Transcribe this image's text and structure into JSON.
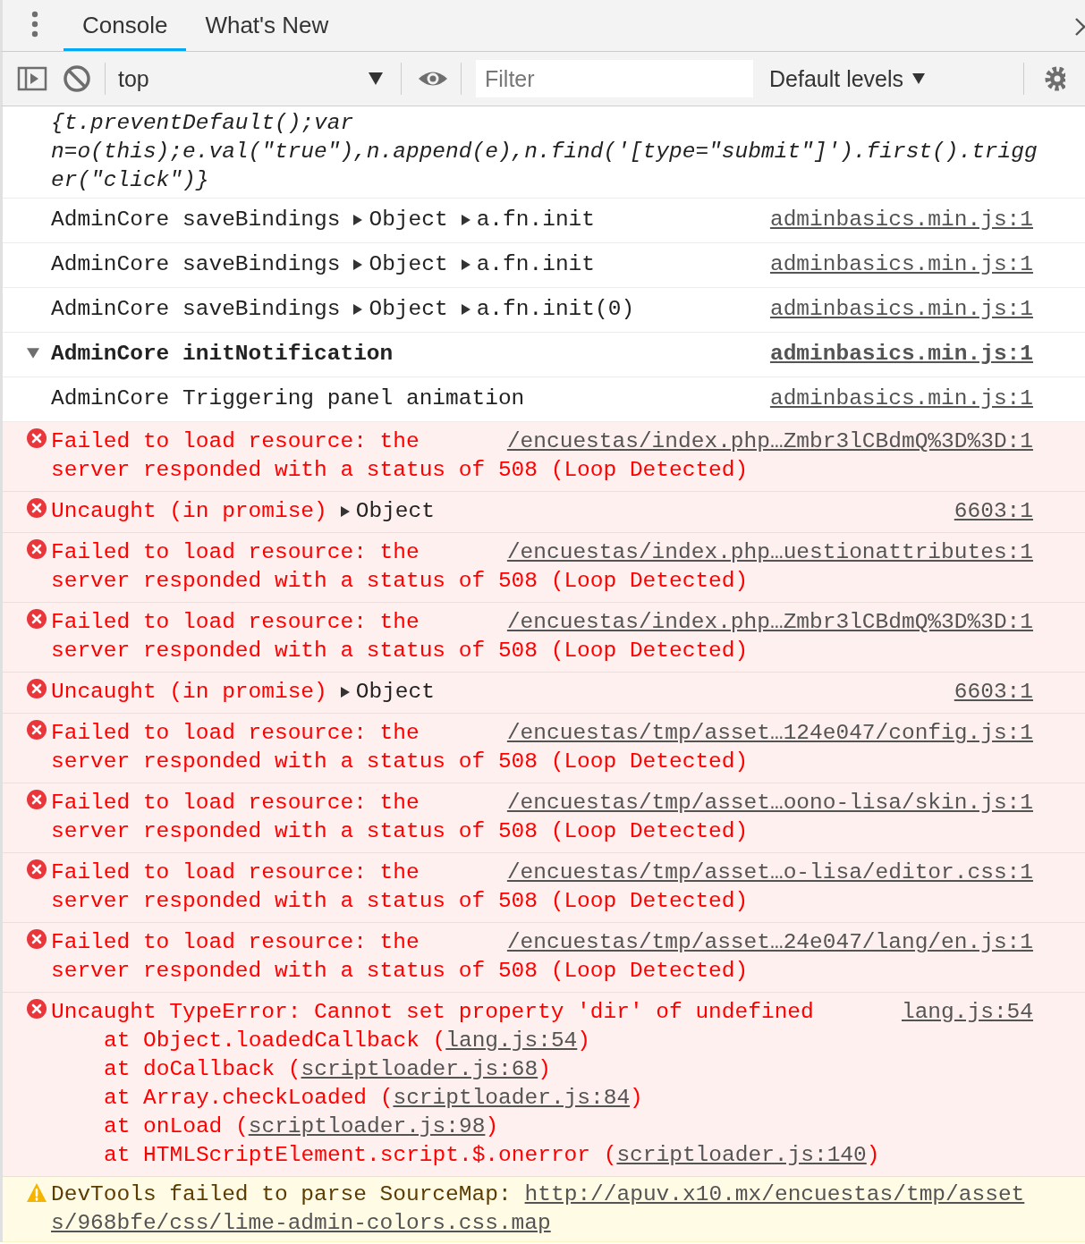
{
  "tabs": [
    {
      "label": "Console",
      "selected": true
    },
    {
      "label": "What's New",
      "selected": false
    }
  ],
  "toolbar": {
    "context": "top",
    "filter": {
      "placeholder": "Filter"
    },
    "levels": "Default levels"
  },
  "messages": [
    {
      "kind": "code",
      "text": "{t.preventDefault();var n=o(this);e.val(\"true\"),n.append(e),n.find('[type=\"submit\"]').first().trigger(\"click\")}"
    },
    {
      "kind": "log",
      "text": "AdminCore saveBindings",
      "objects": [
        "Object",
        "a.fn.init"
      ],
      "source": "adminbasics.min.js:1"
    },
    {
      "kind": "log",
      "text": "AdminCore saveBindings",
      "objects": [
        "Object",
        "a.fn.init"
      ],
      "source": "adminbasics.min.js:1"
    },
    {
      "kind": "log",
      "text": "AdminCore saveBindings",
      "objects": [
        "Object",
        "a.fn.init(0)"
      ],
      "source": "adminbasics.min.js:1"
    },
    {
      "kind": "group",
      "expanded": true,
      "text": "AdminCore initNotification",
      "source": "adminbasics.min.js:1"
    },
    {
      "kind": "log",
      "text": "AdminCore Triggering panel animation",
      "source": "adminbasics.min.js:1"
    },
    {
      "kind": "error",
      "lines": [
        "Failed to load resource: the",
        "server responded with a status of 508 (Loop Detected)"
      ],
      "source": "/encuestas/index.php…Zmbr3lCBdmQ%3D%3D:1"
    },
    {
      "kind": "error",
      "lines": [
        "Uncaught (in promise)"
      ],
      "objects": [
        "Object"
      ],
      "source": "6603:1"
    },
    {
      "kind": "error",
      "lines": [
        "Failed to load resource: the",
        "server responded with a status of 508 (Loop Detected)"
      ],
      "source": "/encuestas/index.php…uestionattributes:1"
    },
    {
      "kind": "error",
      "lines": [
        "Failed to load resource: the",
        "server responded with a status of 508 (Loop Detected)"
      ],
      "source": "/encuestas/index.php…Zmbr3lCBdmQ%3D%3D:1"
    },
    {
      "kind": "error",
      "lines": [
        "Uncaught (in promise)"
      ],
      "objects": [
        "Object"
      ],
      "source": "6603:1"
    },
    {
      "kind": "error",
      "lines": [
        "Failed to load resource: the",
        "server responded with a status of 508 (Loop Detected)"
      ],
      "source": "/encuestas/tmp/asset…124e047/config.js:1"
    },
    {
      "kind": "error",
      "lines": [
        "Failed to load resource: the",
        "server responded with a status of 508 (Loop Detected)"
      ],
      "source": "/encuestas/tmp/asset…oono-lisa/skin.js:1"
    },
    {
      "kind": "error",
      "lines": [
        "Failed to load resource: the",
        "server responded with a status of 508 (Loop Detected)"
      ],
      "source": "/encuestas/tmp/asset…o-lisa/editor.css:1"
    },
    {
      "kind": "error",
      "lines": [
        "Failed to load resource: the",
        "server responded with a status of 508 (Loop Detected)"
      ],
      "source": "/encuestas/tmp/asset…24e047/lang/en.js:1"
    },
    {
      "kind": "error",
      "lines": [
        "Uncaught TypeError: Cannot set property 'dir' of undefined"
      ],
      "source": "lang.js:54",
      "stack": [
        {
          "before": "at Object.loadedCallback (",
          "link": "lang.js:54",
          "after": ")"
        },
        {
          "before": "at doCallback (",
          "link": "scriptloader.js:68",
          "after": ")"
        },
        {
          "before": "at Array.checkLoaded (",
          "link": "scriptloader.js:84",
          "after": ")"
        },
        {
          "before": "at onLoad (",
          "link": "scriptloader.js:98",
          "after": ")"
        },
        {
          "before": "at HTMLScriptElement.script.$.onerror (",
          "link": "scriptloader.js:140",
          "after": ")"
        }
      ]
    },
    {
      "kind": "warning",
      "text": "DevTools failed to parse SourceMap:",
      "link_lines": [
        "http://apuv.x10.mx/encuestas/tmp/asset",
        "s/968bfe/css/lime-admin-colors.css.map"
      ]
    }
  ]
}
